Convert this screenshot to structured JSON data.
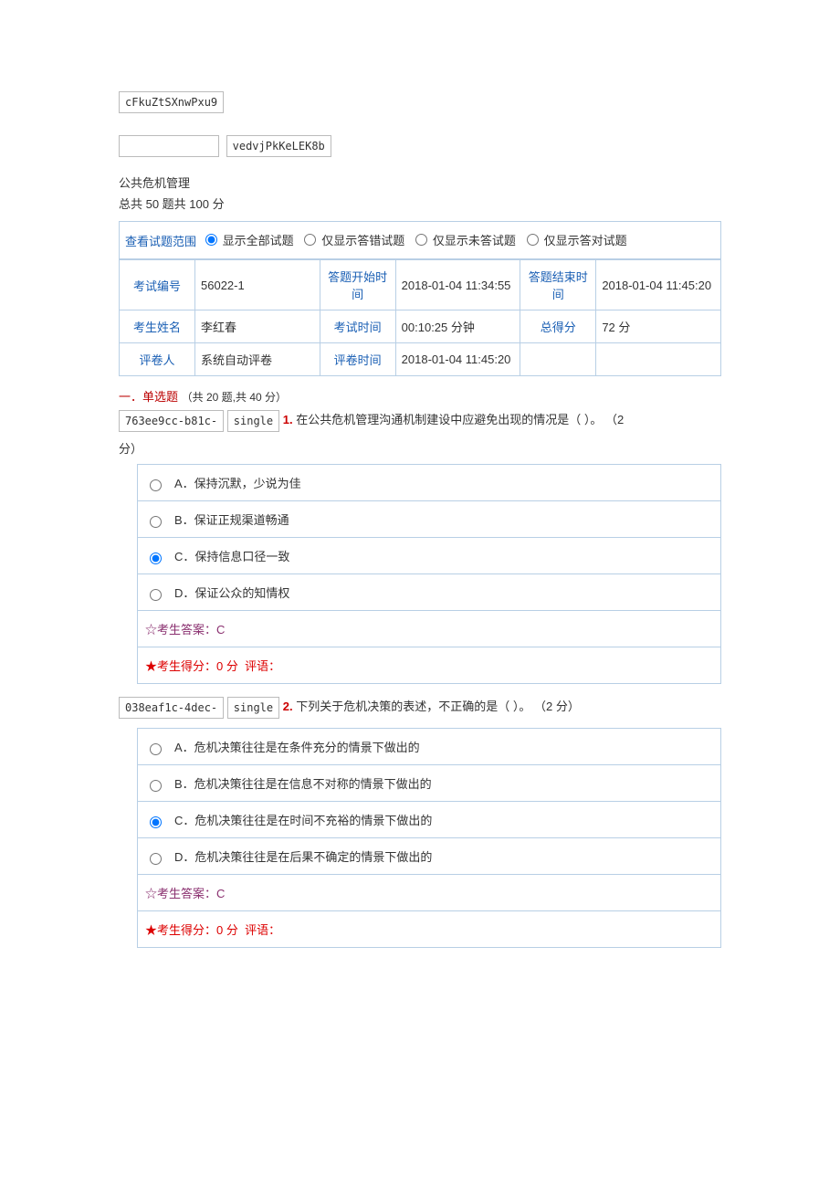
{
  "token1": "cFkuZtSXnwPxu9",
  "token2_left": "",
  "token2_right": "vedvjPkKeLEK8b",
  "title": "公共危机管理",
  "subtitle": "总共 50 题共 100 分",
  "filter": {
    "label": "查看试题范围",
    "opts": [
      "显示全部试题",
      "仅显示答错试题",
      "仅显示未答试题",
      "仅显示答对试题"
    ]
  },
  "info": {
    "exam_id_label": "考试编号",
    "exam_id": "56022-1",
    "start_label": "答题开始时间",
    "start": "2018-01-04 11:34:55",
    "end_label": "答题结束时间",
    "end": "2018-01-04 11:45:20",
    "name_label": "考生姓名",
    "name": "李红春",
    "dur_label": "考试时间",
    "dur": "00:10:25 分钟",
    "score_label": "总得分",
    "score": "72 分",
    "grader_label": "评卷人",
    "grader": "系统自动评卷",
    "gtime_label": "评卷时间",
    "gtime": "2018-01-04 11:45:20"
  },
  "section": {
    "name": "一．单选题",
    "sub": "（共 20 题,共 40 分）"
  },
  "q1": {
    "code1": "763ee9cc-b81c-",
    "code2": "single",
    "num": "1.",
    "text": "在公共危机管理沟通机制建设中应避免出现的情况是（  ）。",
    "pts": "（2",
    "pts2": "分）",
    "A": "A．保持沉默，少说为佳",
    "B": "B．保证正规渠道畅通",
    "C": "C．保持信息口径一致",
    "D": "D．保证公众的知情权",
    "ans_label": "☆考生答案：",
    "ans": "C",
    "score_label": "★考生得分：",
    "score_val": "0 分",
    "comment_label": "评语："
  },
  "q2": {
    "code1": "038eaf1c-4dec-",
    "code2": "single",
    "num": "2.",
    "text": "下列关于危机决策的表述，不正确的是（  ）。",
    "pts": "（2 分）",
    "A": "A．危机决策往往是在条件充分的情景下做出的",
    "B": "B．危机决策往往是在信息不对称的情景下做出的",
    "C": "C．危机决策往往是在时间不充裕的情景下做出的",
    "D": "D．危机决策往往是在后果不确定的情景下做出的",
    "ans_label": "☆考生答案：",
    "ans": "C",
    "score_label": "★考生得分：",
    "score_val": "0 分",
    "comment_label": "评语："
  }
}
